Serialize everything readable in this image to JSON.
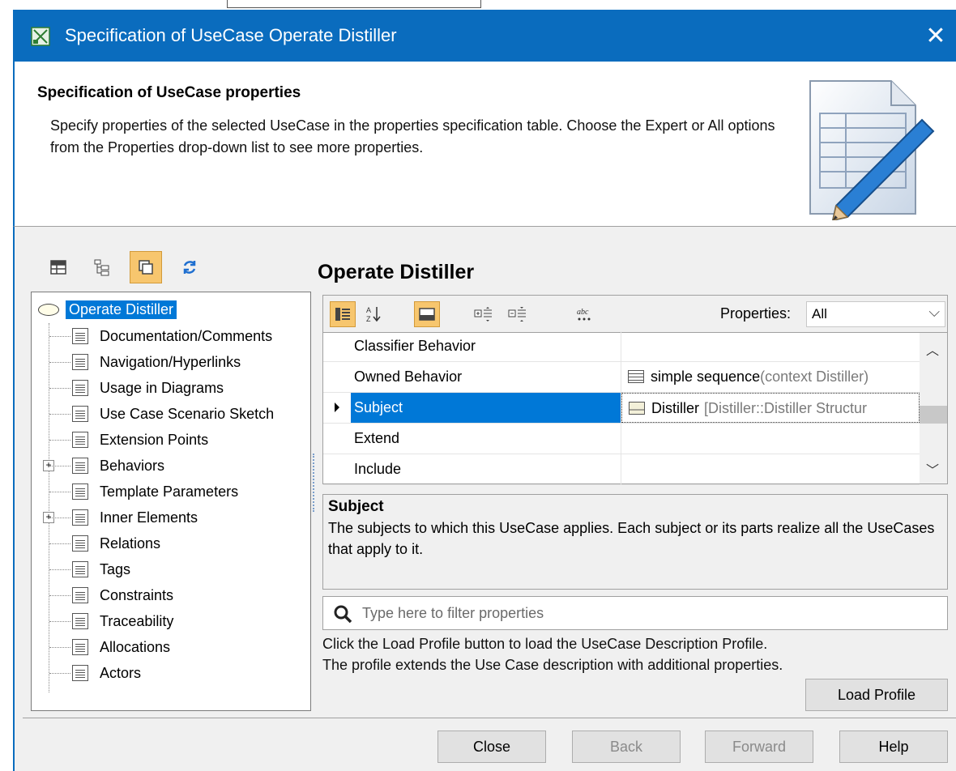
{
  "window": {
    "title": "Specification of UseCase Operate Distiller",
    "close_glyph": "✕"
  },
  "header": {
    "title": "Specification of UseCase properties",
    "description": "Specify properties of the selected UseCase in the properties specification table. Choose the Expert or All options from the Properties drop-down list to see more properties."
  },
  "tree": {
    "root": "Operate Distiller",
    "items": [
      {
        "label": "Documentation/Comments",
        "expandable": false
      },
      {
        "label": "Navigation/Hyperlinks",
        "expandable": false
      },
      {
        "label": "Usage in Diagrams",
        "expandable": false
      },
      {
        "label": "Use Case Scenario Sketch",
        "expandable": false
      },
      {
        "label": "Extension Points",
        "expandable": false
      },
      {
        "label": "Behaviors",
        "expandable": true
      },
      {
        "label": "Template Parameters",
        "expandable": false
      },
      {
        "label": "Inner Elements",
        "expandable": true
      },
      {
        "label": "Relations",
        "expandable": false
      },
      {
        "label": "Tags",
        "expandable": false
      },
      {
        "label": "Constraints",
        "expandable": false
      },
      {
        "label": "Traceability",
        "expandable": false
      },
      {
        "label": "Allocations",
        "expandable": false
      },
      {
        "label": "Actors",
        "expandable": false
      }
    ]
  },
  "element_title": "Operate Distiller",
  "properties": {
    "filter_label": "Properties:",
    "filter_value": "All",
    "rows": [
      {
        "name": "Classifier Behavior",
        "value": "",
        "value_gray": ""
      },
      {
        "name": "Owned Behavior",
        "value": "simple sequence",
        "value_gray": "(context Distiller)"
      },
      {
        "name": "Subject",
        "value": "Distiller",
        "value_gray": "[Distiller::Distiller Structur"
      },
      {
        "name": "Extend",
        "value": "",
        "value_gray": ""
      },
      {
        "name": "Include",
        "value": "",
        "value_gray": ""
      }
    ],
    "selected_row": "Subject"
  },
  "description": {
    "title": "Subject",
    "text": "The subjects to which this UseCase applies. Each subject or its parts realize all the UseCases that apply to it."
  },
  "filter": {
    "placeholder": "Type here to filter properties"
  },
  "hint": {
    "line1": "Click the Load Profile button to load the UseCase Description Profile.",
    "line2": "The profile extends the Use Case description with additional properties."
  },
  "buttons": {
    "load_profile": "Load Profile",
    "close": "Close",
    "back": "Back",
    "forward": "Forward",
    "help": "Help"
  },
  "toolbar_icons": [
    "table-icon",
    "tree-icon",
    "overlap-view-icon",
    "refresh-icon"
  ],
  "colors": {
    "title_bar": "#0a6cbe",
    "selection": "#0078d7",
    "toggle_on": "#f7c66e"
  }
}
